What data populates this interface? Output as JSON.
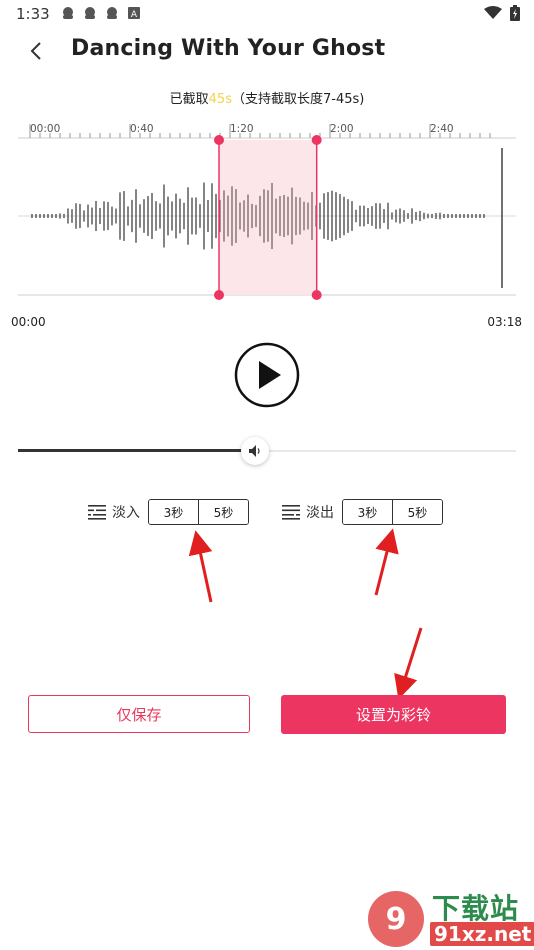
{
  "status_bar": {
    "time": "1:33",
    "notification_icons": [
      "avatar-notification-icon",
      "avatar-notification-icon",
      "avatar-notification-icon",
      "app-a-icon"
    ],
    "system_icons": [
      "wifi-icon",
      "battery-charging-icon"
    ]
  },
  "header": {
    "title": "Dancing With Your Ghost",
    "back_icon": "back-arrow-icon"
  },
  "clip_info": {
    "prefix": "已截取",
    "duration": "45s",
    "note": "（支持截取长度7-45s)"
  },
  "timeline": {
    "ticks": [
      "00:00",
      "0:40",
      "1:20",
      "2:00",
      "2:40"
    ],
    "start_time": "00:00",
    "end_time": "03:18",
    "selection_start_fraction": 0.4,
    "selection_end_fraction": 0.61
  },
  "player": {
    "play_icon": "play-icon",
    "volume_icon": "volume-icon",
    "volume_fraction": 0.475
  },
  "fade_in": {
    "label": "淡入",
    "options": [
      "3秒",
      "5秒"
    ],
    "icon": "fade-in-icon"
  },
  "fade_out": {
    "label": "淡出",
    "options": [
      "3秒",
      "5秒"
    ],
    "icon": "fade-out-icon"
  },
  "actions": {
    "save_only": "仅保存",
    "set_ringtone": "设置为彩铃"
  },
  "watermark": {
    "top": "下载站",
    "bottom": "91xz.net"
  },
  "colors": {
    "accent": "#ec3560",
    "selection_fill": "#fce3e8",
    "highlight": "#f3d34a",
    "annotation_arrow": "#e02020"
  }
}
